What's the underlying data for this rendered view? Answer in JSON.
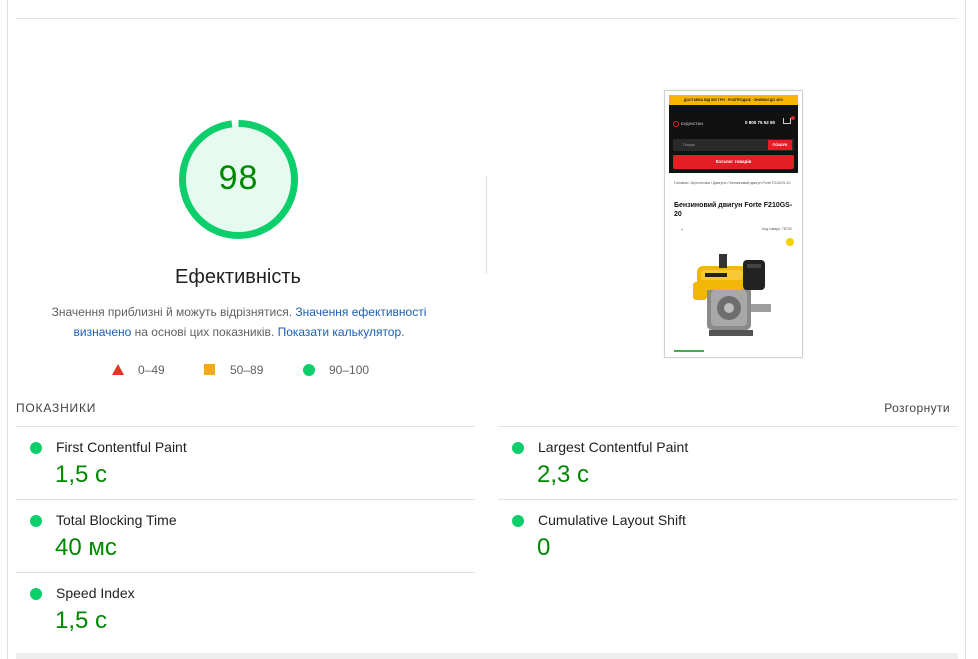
{
  "gauge": {
    "score": "98",
    "score_fraction": 0.98,
    "title": "Ефективність",
    "color_ring": "#0cce6b",
    "color_text": "#008800",
    "color_fill": "#e6faef"
  },
  "description": {
    "text_1": "Значення приблизні й можуть відрізнятися. ",
    "link_1": "Значення ефективності визначено",
    "text_2": " на основі цих показників. ",
    "link_2": "Показати калькулятор",
    "text_3": "."
  },
  "legend": [
    {
      "label": "0–49",
      "icon": "red-triangle",
      "color": "#eb3223"
    },
    {
      "label": "50–89",
      "icon": "orange-square",
      "color": "#f5a623"
    },
    {
      "label": "90–100",
      "icon": "green-circle",
      "color": "#0cce6b"
    }
  ],
  "screenshot": {
    "promo": "ДОСТАВКА ВІД 500 ГРН · РОЗПРОДАЖ · ЗНИЖКИ ДО 40%",
    "logo": "БУДІНСТАН",
    "phone": "0 800 75 52 50",
    "search_placeholder": "Пошук",
    "search_button": "ПОШУК",
    "catalog_button": "Каталог товарів",
    "breadcrumbs": "Головна / Агротехніка / Двигуни / Бензиновий двигун Forte F210GS-20",
    "product_title": "Бензиновий двигун Forte F210GS-20",
    "product_code": "Код товару: 78726",
    "reviews": "0"
  },
  "metrics_section": {
    "title": "ПОКАЗНИКИ",
    "expand_label": "Розгорнути"
  },
  "metrics": [
    {
      "name": "First Contentful Paint",
      "value": "1,5 с"
    },
    {
      "name": "Largest Contentful Paint",
      "value": "2,3 с"
    },
    {
      "name": "Total Blocking Time",
      "value": "40 мс"
    },
    {
      "name": "Cumulative Layout Shift",
      "value": "0"
    },
    {
      "name": "Speed Index",
      "value": "1,5 с"
    }
  ]
}
